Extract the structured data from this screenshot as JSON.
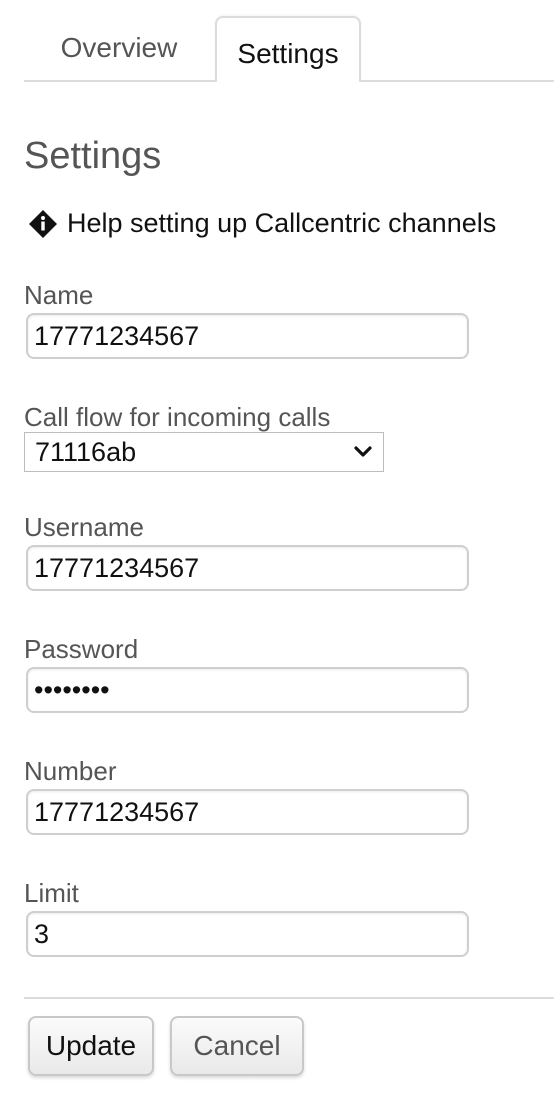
{
  "tabs": [
    {
      "label": "Overview",
      "active": false
    },
    {
      "label": "Settings",
      "active": true
    }
  ],
  "page": {
    "title": "Settings",
    "help_link": "Help setting up Callcentric channels"
  },
  "form": {
    "name": {
      "label": "Name",
      "value": "17771234567"
    },
    "call_flow": {
      "label": "Call flow for incoming calls",
      "value": "71116ab"
    },
    "username": {
      "label": "Username",
      "value": "17771234567"
    },
    "password": {
      "label": "Password",
      "value": "••••••••"
    },
    "number": {
      "label": "Number",
      "value": "17771234567"
    },
    "limit": {
      "label": "Limit",
      "value": "3"
    }
  },
  "actions": {
    "update_label": "Update",
    "cancel_label": "Cancel"
  },
  "icons": {
    "help": "info-diamond-icon",
    "select": "chevron-down-icon"
  }
}
